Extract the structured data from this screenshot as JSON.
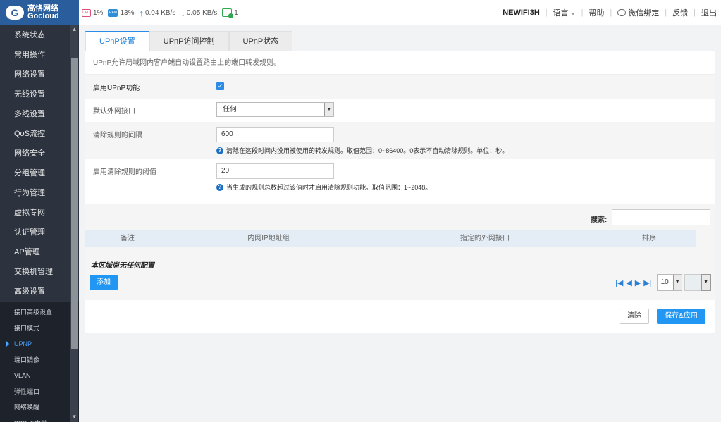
{
  "brand": {
    "name_cn": "高恪网络",
    "name_en": "Gocloud"
  },
  "stats": {
    "cpu_chip": "CPU",
    "cpu": "1%",
    "ram_chip": "RAM",
    "ram": "13%",
    "upload": "0.04 KB/s",
    "download": "0.05 KB/s",
    "online": "1"
  },
  "topnav": {
    "device": "NEWIFI3H",
    "language": "语言",
    "help": "帮助",
    "wechat": "微信绑定",
    "feedback": "反馈",
    "logout": "退出"
  },
  "sidebar": {
    "menu": [
      "系统状态",
      "常用操作",
      "网络设置",
      "无线设置",
      "多线设置",
      "QoS流控",
      "网络安全",
      "分组管理",
      "行为管理",
      "虚拟专网",
      "认证管理",
      "AP管理",
      "交换机管理",
      "高级设置"
    ],
    "submenu": [
      "接口高级设置",
      "接口模式",
      "UPNP",
      "端口镜像",
      "VLAN",
      "弹性端口",
      "网络唤醒",
      "PPPoE中继"
    ],
    "active_sub": "UPNP"
  },
  "tabs": [
    "UPnP设置",
    "UPnP访问控制",
    "UPnP状态"
  ],
  "settings": {
    "description": "UPnP允许局域网内客户端自动设置路由上的端口转发规则。",
    "enable_label": "启用UPnP功能",
    "wan_label": "默认外网接口",
    "wan_value": "任何",
    "interval_label": "清除规则的间隔",
    "interval_value": "600",
    "interval_hint": "清除在这段时间内没用被使用的转发规则。取值范围：0~86400。0表示不自动清除规则。单位：秒。",
    "threshold_label": "启用清除规则的阈值",
    "threshold_value": "20",
    "threshold_hint": "当生成的规则总数超过该值时才启用清除规则功能。取值范围：1~2048。"
  },
  "table": {
    "search_label": "搜索:",
    "columns": [
      "备注",
      "内网IP地址组",
      "指定的外网接口",
      "排序"
    ],
    "empty_text": "本区域尚无任何配置",
    "add_label": "添加",
    "page_size": "10"
  },
  "actions": {
    "clear": "清除",
    "save": "保存&应用"
  }
}
